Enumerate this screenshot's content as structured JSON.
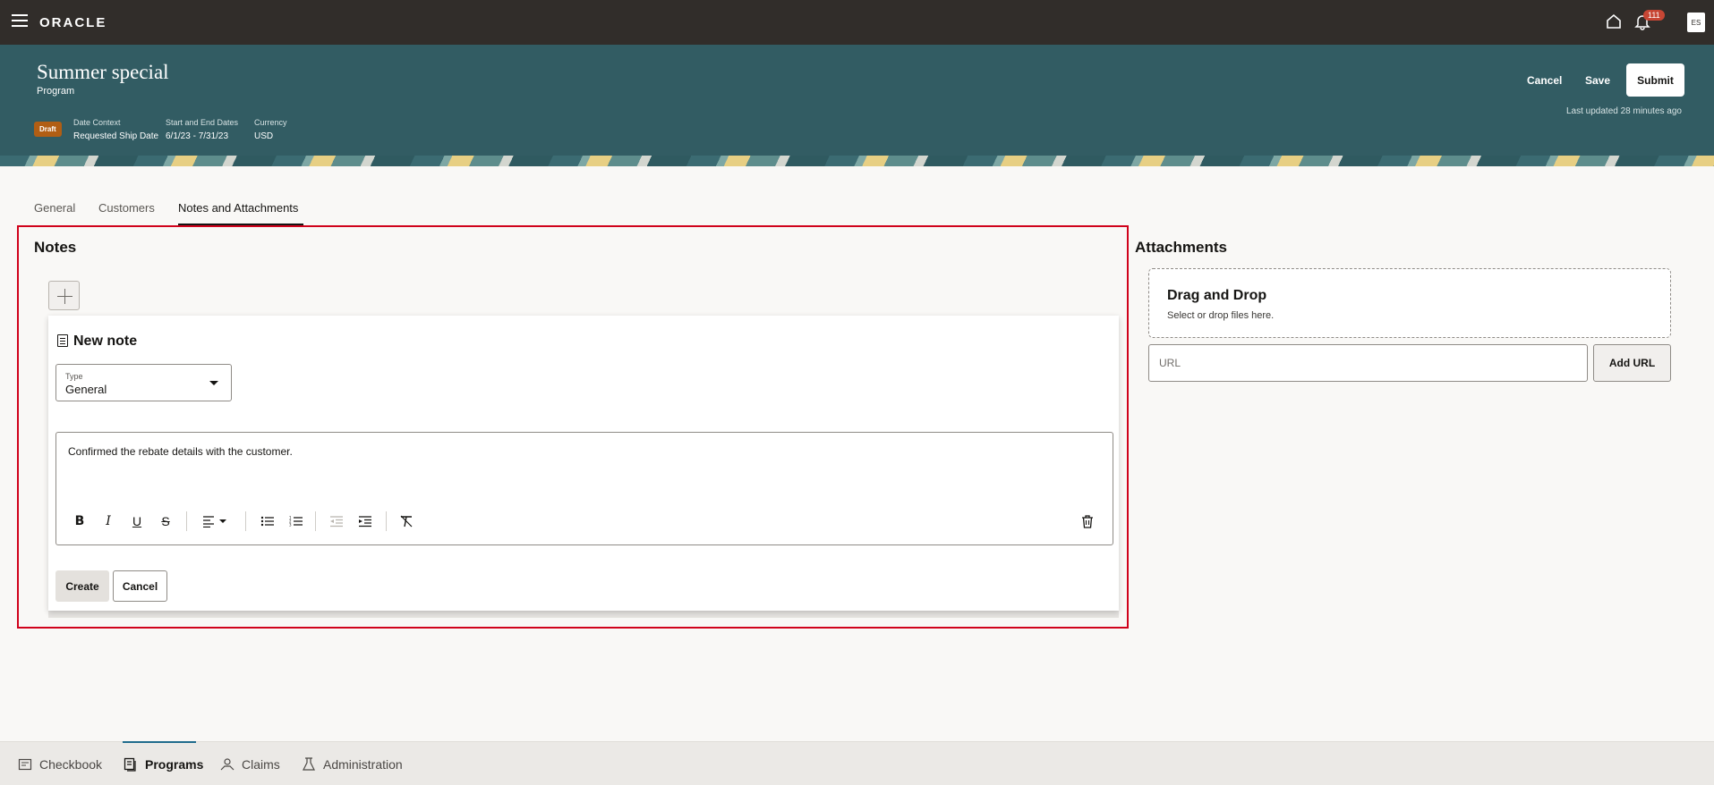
{
  "topbar": {
    "logo": "ORACLE",
    "notification_count": "111",
    "avatar_initials": "ES"
  },
  "header": {
    "title": "Summer special",
    "subtitle": "Program",
    "status_badge": "Draft",
    "meta": [
      {
        "label": "Date Context",
        "value": "Requested Ship Date"
      },
      {
        "label": "Start and End Dates",
        "value": "6/1/23 - 7/31/23"
      },
      {
        "label": "Currency",
        "value": "USD"
      }
    ],
    "cancel_label": "Cancel",
    "save_label": "Save",
    "submit_label": "Submit",
    "last_updated": "Last updated 28 minutes ago"
  },
  "tabs": [
    {
      "label": "General"
    },
    {
      "label": "Customers"
    },
    {
      "label": "Notes and Attachments",
      "active": true
    }
  ],
  "notes": {
    "title": "Notes",
    "new_note_title": "New note",
    "type_label": "Type",
    "type_value": "General",
    "editor_text": "Confirmed the rebate details with the customer.",
    "create_label": "Create",
    "cancel_label": "Cancel",
    "toolbar": [
      "bold-icon",
      "italic-icon",
      "underline-icon",
      "strikethrough-icon",
      "align-left-icon",
      "bullet-list-icon",
      "numbered-list-icon",
      "outdent-icon",
      "indent-icon",
      "clear-format-icon",
      "trash-icon"
    ]
  },
  "attachments": {
    "title": "Attachments",
    "dropzone_title": "Drag and Drop",
    "dropzone_subtitle": "Select or drop files here.",
    "url_placeholder": "URL",
    "add_url_label": "Add URL"
  },
  "bottom_nav": [
    {
      "label": "Checkbook",
      "icon": "checkbook-icon"
    },
    {
      "label": "Programs",
      "icon": "programs-icon",
      "active": true
    },
    {
      "label": "Claims",
      "icon": "claims-icon"
    },
    {
      "label": "Administration",
      "icon": "administration-icon"
    }
  ],
  "colors": {
    "topbar": "#312d2a",
    "banner": "#325c63",
    "highlight_border": "#d0021b",
    "badge": "#b15e14"
  }
}
